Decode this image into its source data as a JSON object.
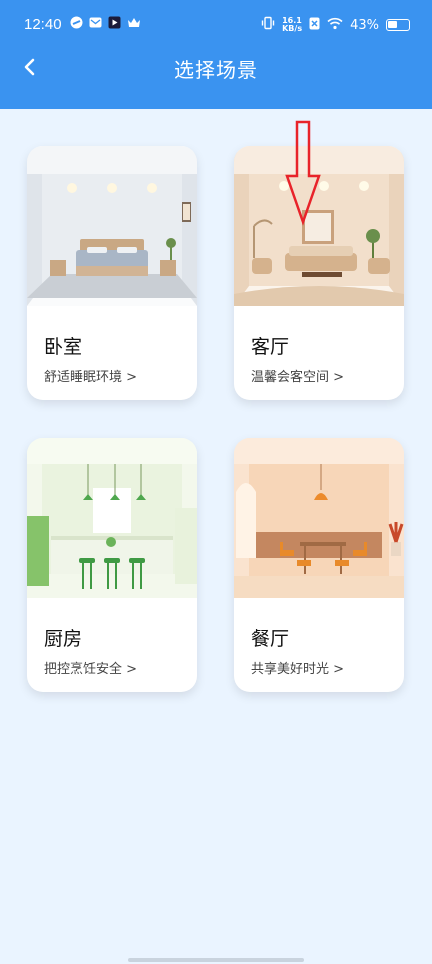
{
  "status_bar": {
    "time": "12:40",
    "network_speed": "16.1",
    "network_unit": "KB/s",
    "battery": "43%"
  },
  "header": {
    "title": "选择场景",
    "back_icon": "chevron-left-icon"
  },
  "scenes": [
    {
      "name": "卧室",
      "desc": "舒适睡眠环境 >"
    },
    {
      "name": "客厅",
      "desc": "温馨会客空间 >"
    },
    {
      "name": "厨房",
      "desc": "把控烹饪安全 >"
    },
    {
      "name": "餐厅",
      "desc": "共享美好时光 >"
    }
  ],
  "colors": {
    "header": "#3a93f0",
    "background": "#eaf4ff",
    "arrow": "#e8232a"
  }
}
